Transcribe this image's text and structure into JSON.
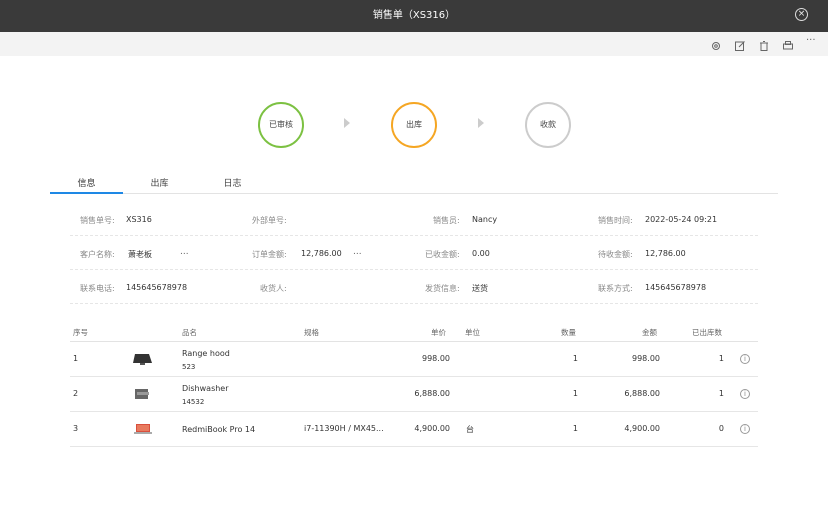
{
  "window": {
    "title": "销售单（XS316）"
  },
  "workflow": {
    "steps": [
      "已审核",
      "出库",
      "收款"
    ],
    "colors": [
      "#7cc142",
      "#f5a623",
      "#cccccc"
    ]
  },
  "tabs": [
    "信息",
    "出库",
    "日志"
  ],
  "info": {
    "order_no_label": "销售单号:",
    "order_no": "XS316",
    "external_label": "外部单号:",
    "salesperson_label": "销售员:",
    "salesperson": "Nancy",
    "sale_time_label": "销售时间:",
    "sale_time": "2022-05-24 09:21",
    "customer_label": "客户名称:",
    "customer": "萧老板",
    "order_amount_label": "订单金额:",
    "order_amount": "12,786.00",
    "received_label": "已收金额:",
    "received": "0.00",
    "pending_label": "待收金额:",
    "pending": "12,786.00",
    "phone_label": "联系电话:",
    "phone": "145645678978",
    "receiver_label": "收货人:",
    "shipping_label": "发货信息:",
    "shipping": "送货",
    "contact_label": "联系方式:",
    "contact": "145645678978",
    "more": "..."
  },
  "table": {
    "headers": [
      "序号",
      "品名",
      "规格",
      "单价",
      "单位",
      "数量",
      "金额",
      "已出库数"
    ],
    "rows": [
      {
        "idx": "1",
        "name": "Range hood",
        "code": "523",
        "spec": "",
        "price": "998.00",
        "unit": "",
        "qty": "1",
        "amount": "998.00",
        "out": "1"
      },
      {
        "idx": "2",
        "name": "Dishwasher",
        "code": "14532",
        "spec": "",
        "price": "6,888.00",
        "unit": "",
        "qty": "1",
        "amount": "6,888.00",
        "out": "1"
      },
      {
        "idx": "3",
        "name": "RedmiBook Pro 14",
        "code": "",
        "spec": "i7-11390H / MX45...",
        "price": "4,900.00",
        "unit": "台",
        "qty": "1",
        "amount": "4,900.00",
        "out": "0"
      }
    ]
  },
  "icons": {
    "close": "×",
    "info": "i",
    "more": "···"
  }
}
